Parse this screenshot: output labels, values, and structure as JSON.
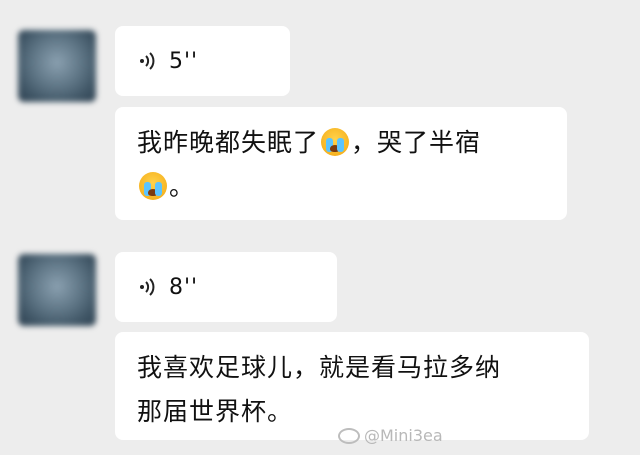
{
  "messages": [
    {
      "voice_duration": "5''",
      "text_parts": [
        "我昨晚都失眠了",
        "，哭了半宿",
        "。"
      ],
      "emoji": "crying-face"
    },
    {
      "voice_duration": "8''",
      "text_line1": "我喜欢足球儿，就是看马拉多纳",
      "text_line2": "那届世界杯。"
    }
  ],
  "watermark": {
    "text": "@Mini3ea",
    "icon": "weibo-logo"
  }
}
